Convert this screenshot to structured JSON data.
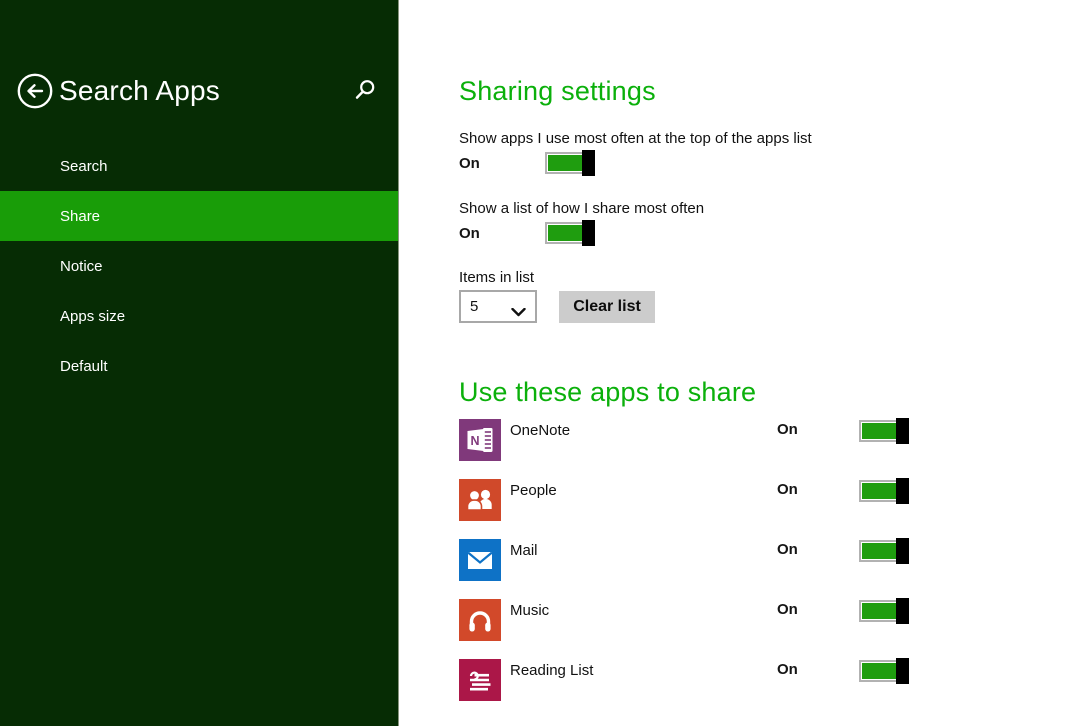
{
  "colors": {
    "sidebar_bg": "#062c04",
    "selected_item_bg": "#199d08",
    "heading_green": "#0bb00b",
    "toggle_fill_green": "#1f9d0f",
    "thumb_black": "#000000",
    "clear_button_bg": "#cccccc"
  },
  "sidebar": {
    "title": "Search Apps",
    "back_icon": "back-arrow-circle-icon",
    "search_icon": "magnifier-icon",
    "items": [
      {
        "label": "Search",
        "selected": false
      },
      {
        "label": "Share",
        "selected": true
      },
      {
        "label": "Notice",
        "selected": false
      },
      {
        "label": "Apps size",
        "selected": false
      },
      {
        "label": "Default",
        "selected": false
      }
    ]
  },
  "sharing": {
    "heading": "Sharing settings",
    "toggles": [
      {
        "label": "Show apps I use most often at the top of the apps list",
        "state": "On"
      },
      {
        "label": "Show a list of how I share most often",
        "state": "On"
      }
    ],
    "items_in_list": {
      "label": "Items in list",
      "selected_value": "5",
      "clear_button_label": "Clear list"
    }
  },
  "share_apps": {
    "heading": "Use these apps to share",
    "apps": [
      {
        "name": "OneNote",
        "state": "On",
        "tile_color": "#80397b",
        "icon": "onenote-icon"
      },
      {
        "name": "People",
        "state": "On",
        "tile_color": "#d0492a",
        "icon": "people-icon"
      },
      {
        "name": "Mail",
        "state": "On",
        "tile_color": "#0e72c6",
        "icon": "mail-icon"
      },
      {
        "name": "Music",
        "state": "On",
        "tile_color": "#d2492a",
        "icon": "music-icon"
      },
      {
        "name": "Reading List",
        "state": "On",
        "tile_color": "#ab1748",
        "icon": "reading-list-icon"
      }
    ]
  }
}
